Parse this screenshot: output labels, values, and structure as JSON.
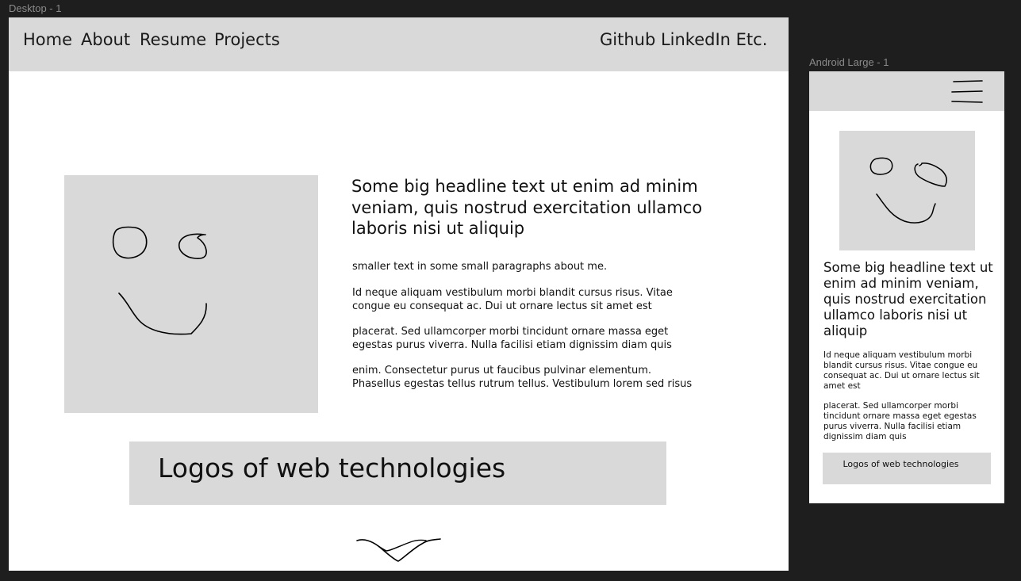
{
  "canvas": {
    "desktop_frame_label": "Desktop - 1",
    "android_frame_label": "Android Large - 1"
  },
  "desktop": {
    "nav": {
      "home": "Home",
      "about": "About",
      "resume": "Resume",
      "projects": "Projects",
      "socials": "Github LinkedIn Etc."
    },
    "hero": {
      "headline": "Some big headline text ut enim ad minim veniam, quis nostrud exercitation ullamco laboris nisi ut aliquip",
      "paragraphs": [
        "smaller text in some small paragraphs about me.",
        "Id neque aliquam vestibulum morbi blandit cursus risus. Vitae congue eu consequat ac. Dui ut ornare lectus sit amet est",
        "placerat. Sed ullamcorper morbi tincidunt ornare massa eget egestas purus viverra. Nulla facilisi etiam dignissim diam quis",
        "enim. Consectetur purus ut faucibus pulvinar elementum. Phasellus egestas tellus rutrum tellus. Vestibulum lorem sed risus"
      ]
    },
    "logos_banner": "Logos of web technologies"
  },
  "android": {
    "hero": {
      "headline": "Some big headline text ut enim ad minim veniam, quis nostrud exercitation ullamco laboris nisi ut aliquip",
      "paragraphs": [
        "Id neque aliquam vestibulum morbi blandit cursus risus. Vitae congue eu consequat ac. Dui ut ornare lectus sit amet est",
        "placerat. Sed ullamcorper morbi tincidunt ornare massa eget egestas purus viverra. Nulla facilisi etiam dignissim diam quis"
      ]
    },
    "logos_banner": "Logos of web technologies"
  },
  "icons": {
    "hero_placeholder": "smiley-sketch-icon",
    "scroll_hint": "chevron-down-icon",
    "mobile_menu": "hamburger-menu-icon"
  },
  "colors": {
    "canvas_bg": "#1e1e1e",
    "frame_bg": "#ffffff",
    "placeholder_gray": "#d9d9d9",
    "text": "#111111",
    "frame_label": "#8a8a8a"
  }
}
